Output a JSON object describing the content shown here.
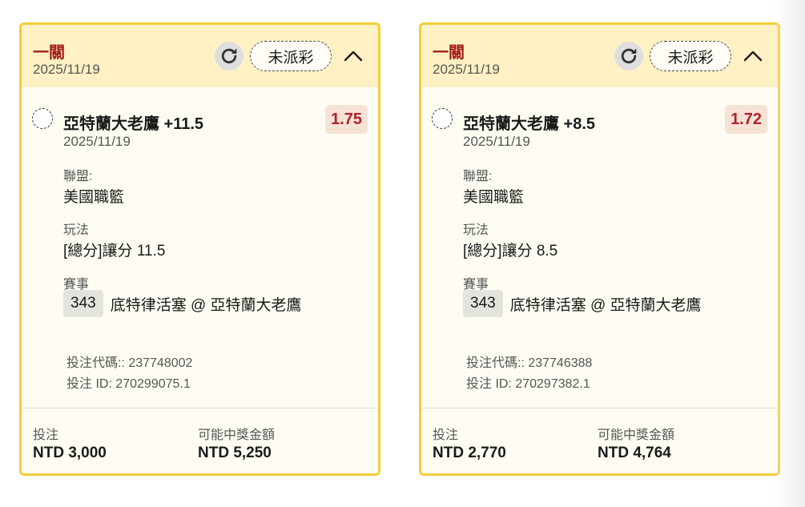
{
  "colors": {
    "card_border": "#f1cf3a",
    "header_bg": "#fff1c3",
    "card_bg": "#fffdf3",
    "bet_type_text": "#a11c1c",
    "odds_text": "#b0222a",
    "odds_bg": "#f7e3d6"
  },
  "icons": {
    "refresh": "refresh-icon",
    "collapse": "chevron-up-icon",
    "select": "radio-circle-icon"
  },
  "cards": [
    {
      "bet_type": "一關",
      "date": "2025/11/19",
      "status": "未派彩",
      "selection": "亞特蘭大老鷹 +11.5",
      "odds": "1.75",
      "selection_date": "2025/11/19",
      "league_label": "聯盟:",
      "league": "美國職籃",
      "market_label": "玩法",
      "market": "[總分]讓分 11.5",
      "event_label": "賽事",
      "event_number": "343",
      "event_name": "底特律活塞 @ 亞特蘭大老鷹",
      "bet_code": "投注代碼:: 237748002",
      "bet_id": "投注 ID: 270299075.1",
      "stake_label": "投注",
      "stake": "NTD 3,000",
      "payout_label": "可能中獎金額",
      "payout": "NTD 5,250"
    },
    {
      "bet_type": "一關",
      "date": "2025/11/19",
      "status": "未派彩",
      "selection": "亞特蘭大老鷹 +8.5",
      "odds": "1.72",
      "selection_date": "2025/11/19",
      "league_label": "聯盟:",
      "league": "美國職籃",
      "market_label": "玩法",
      "market": "[總分]讓分 8.5",
      "event_label": "賽事",
      "event_number": "343",
      "event_name": "底特律活塞 @ 亞特蘭大老鷹",
      "bet_code": "投注代碼:: 237746388",
      "bet_id": "投注 ID: 270297382.1",
      "stake_label": "投注",
      "stake": "NTD 2,770",
      "payout_label": "可能中獎金額",
      "payout": "NTD 4,764"
    }
  ]
}
